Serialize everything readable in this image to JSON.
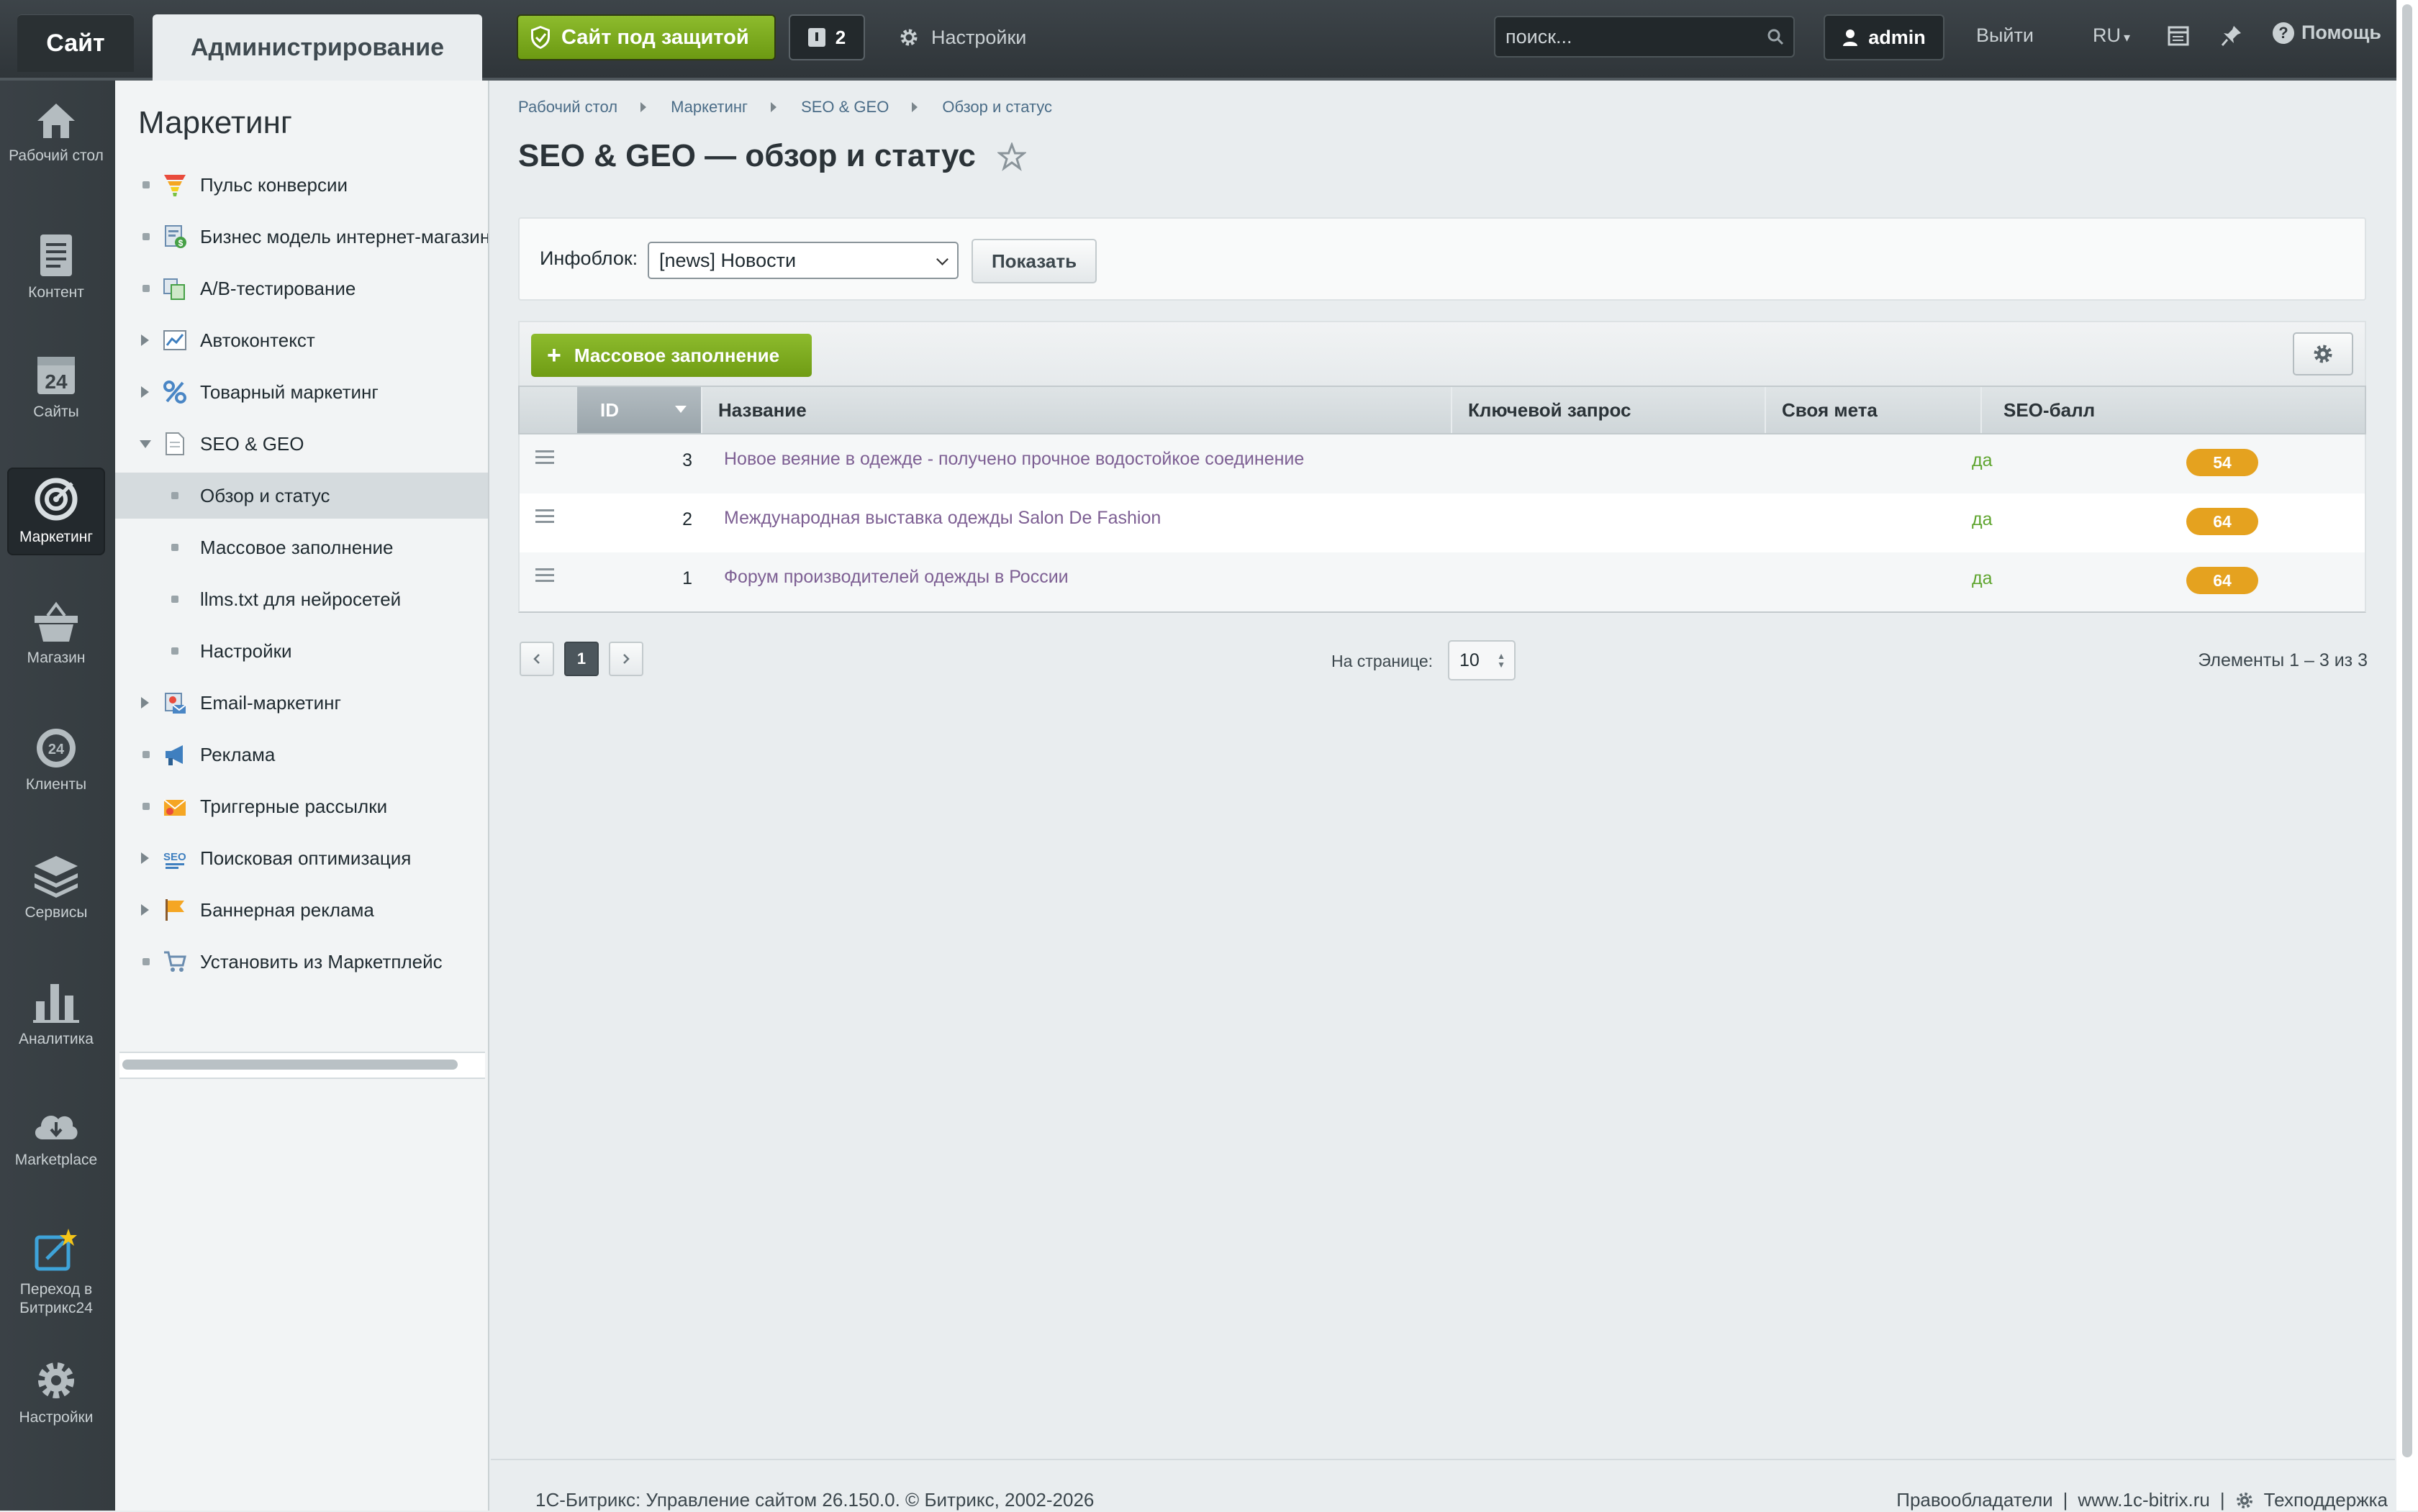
{
  "topbar": {
    "tab_site": "Сайт",
    "tab_admin": "Администрирование",
    "protect_label": "Сайт под защитой",
    "notif_count": "2",
    "settings_label": "Настройки",
    "search_placeholder": "поиск...",
    "user": "admin",
    "logout": "Выйти",
    "lang": "RU",
    "help": "Помощь"
  },
  "iconmenu": {
    "items": [
      {
        "label": "Рабочий стол",
        "icon": "home-icon"
      },
      {
        "label": "Контент",
        "icon": "document-icon"
      },
      {
        "label": "Сайты",
        "icon": "calendar-24-icon"
      },
      {
        "label": "Маркетинг",
        "icon": "target-icon",
        "active": true
      },
      {
        "label": "Магазин",
        "icon": "basket-icon"
      },
      {
        "label": "Клиенты",
        "icon": "clients-24-icon"
      },
      {
        "label": "Сервисы",
        "icon": "layers-icon"
      },
      {
        "label": "Аналитика",
        "icon": "bar-chart-icon"
      },
      {
        "label": "Marketplace",
        "icon": "cloud-download-icon"
      },
      {
        "label": "Переход в Битрикс24",
        "icon": "external-star-icon"
      },
      {
        "label": "Настройки",
        "icon": "gear-icon"
      }
    ]
  },
  "sidebar": {
    "title": "Маркетинг",
    "items": [
      {
        "label": "Пульс конверсии",
        "icon": "funnel-icon"
      },
      {
        "label": "Бизнес модель интернет-магазина",
        "icon": "business-model-icon"
      },
      {
        "label": "A/B-тестирование",
        "icon": "ab-test-icon"
      },
      {
        "label": "Автоконтекст",
        "icon": "autocontext-icon"
      },
      {
        "label": "Товарный маркетинг",
        "icon": "percent-icon"
      },
      {
        "label": "SEO & GEO",
        "icon": "seo-geo-doc-icon"
      },
      {
        "label": "Обзор и статус"
      },
      {
        "label": "Массовое заполнение"
      },
      {
        "label": "llms.txt для нейросетей"
      },
      {
        "label": "Настройки"
      },
      {
        "label": "Email-маркетинг",
        "icon": "email-icon"
      },
      {
        "label": "Реклама",
        "icon": "megaphone-icon"
      },
      {
        "label": "Триггерные рассылки",
        "icon": "trigger-mail-icon"
      },
      {
        "label": "Поисковая оптимизация",
        "icon": "seo-icon"
      },
      {
        "label": "Баннерная реклама",
        "icon": "banner-flag-icon"
      },
      {
        "label": "Установить из Маркетплейс",
        "icon": "cart-icon"
      }
    ]
  },
  "breadcrumbs": [
    "Рабочий стол",
    "Маркетинг",
    "SEO & GEO",
    "Обзор и статус"
  ],
  "page_title": "SEO & GEO — обзор и статус",
  "filter": {
    "label": "Инфоблок:",
    "selected": "[news] Новости",
    "show_button": "Показать"
  },
  "toolbar": {
    "mass_fill": "Массовое заполнение"
  },
  "grid": {
    "columns": [
      "ID",
      "Название",
      "Ключевой запрос",
      "Своя мета",
      "SEO-балл"
    ],
    "rows": [
      {
        "id": "3",
        "name": "Новое веяние в одежде - получено прочное водостойкое соединение",
        "keyword": "",
        "meta": "да",
        "score": "54"
      },
      {
        "id": "2",
        "name": "Международная выставка одежды Salon De Fashion",
        "keyword": "",
        "meta": "да",
        "score": "64"
      },
      {
        "id": "1",
        "name": "Форум производителей одежды в России",
        "keyword": "",
        "meta": "да",
        "score": "64"
      }
    ]
  },
  "pager": {
    "current": "1",
    "per_page_label": "На странице:",
    "per_page": "10",
    "elements": "Элементы 1 – 3 из 3"
  },
  "footer": {
    "copyright": "1С-Битрикс: Управление сайтом 26.150.0. © Битрикс, 2002-2026",
    "rights": "Правообладатели",
    "site": "www.1c-bitrix.ru",
    "support": "Техподдержка"
  },
  "colors": {
    "accent_green": "#7aa81f",
    "score_badge": "#e5a21f",
    "link_purple": "#7d5f93",
    "yes_green": "#5fa52f"
  }
}
